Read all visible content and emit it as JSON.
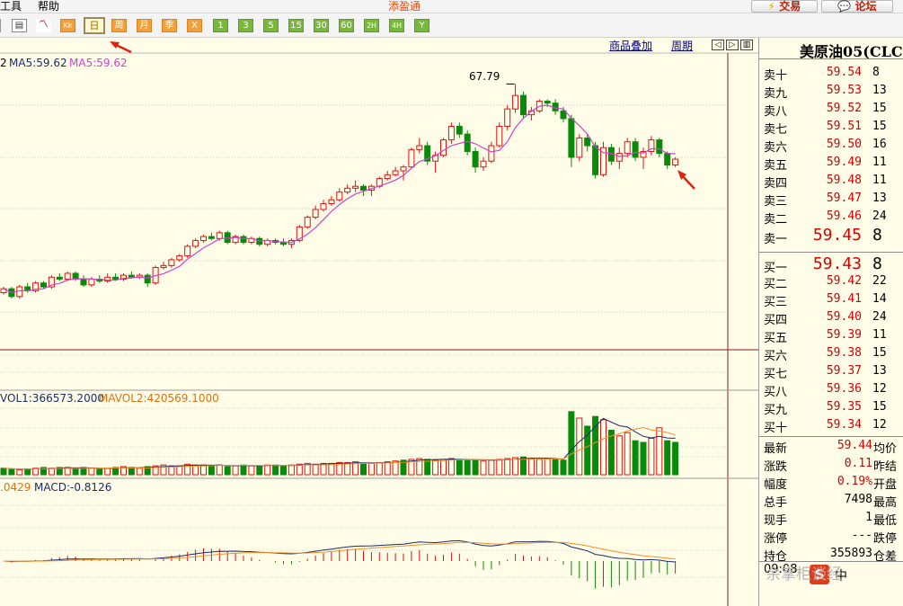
{
  "menu": {
    "items": [
      "工具",
      "帮助"
    ],
    "app_title": "添盈通",
    "trade_btn": "交易",
    "forum_btn": "论坛"
  },
  "toolbar": {
    "period_buttons": [
      "日",
      "周",
      "月",
      "季",
      "X",
      "1",
      "3",
      "5",
      "15",
      "30",
      "60",
      "2H",
      "4H",
      "Y"
    ],
    "active": "日"
  },
  "chart": {
    "links": {
      "overlay": "商品叠加",
      "period": "周期"
    },
    "ma_legend": {
      "ma2": "2",
      "ma5": "MA5:59.62",
      "ma5b": "MA5:59.62"
    },
    "high_label": "67.79",
    "vol_legend": {
      "vol1": "VOL1:366573.2000",
      "mavol2": "MAVOL2:420569.1000"
    },
    "macd_legend": {
      "dea": ".0429",
      "macd": "MACD:-0.8126"
    },
    "colors": {
      "up": "#e01010",
      "down": "#0a8a0a",
      "ma": "#cc44cc",
      "macd_fast": "#1a2d66",
      "macd_slow": "#f0902a",
      "bg": "#fffde8"
    }
  },
  "chart_data": {
    "type": "candlestick",
    "candles_ohlc": [
      [
        57.0,
        57.3,
        56.9,
        57.2
      ],
      [
        57.2,
        57.3,
        56.7,
        56.8
      ],
      [
        56.8,
        57.4,
        56.7,
        57.3
      ],
      [
        57.3,
        57.5,
        57.0,
        57.1
      ],
      [
        57.1,
        57.6,
        57.0,
        57.5
      ],
      [
        57.5,
        57.6,
        57.2,
        57.3
      ],
      [
        57.3,
        57.9,
        57.2,
        57.8
      ],
      [
        57.8,
        58.0,
        57.6,
        57.7
      ],
      [
        57.7,
        58.1,
        57.6,
        58.0
      ],
      [
        58.0,
        58.1,
        57.6,
        57.7
      ],
      [
        57.7,
        57.9,
        57.3,
        57.4
      ],
      [
        57.4,
        57.8,
        57.3,
        57.7
      ],
      [
        57.7,
        57.9,
        57.5,
        57.6
      ],
      [
        57.6,
        58.0,
        57.5,
        57.8
      ],
      [
        57.8,
        58.0,
        57.6,
        57.7
      ],
      [
        57.7,
        58.0,
        57.6,
        57.9
      ],
      [
        57.9,
        58.1,
        57.8,
        57.8
      ],
      [
        57.8,
        58.0,
        57.7,
        57.9
      ],
      [
        57.9,
        58.0,
        57.3,
        57.5
      ],
      [
        57.5,
        58.4,
        57.4,
        58.3
      ],
      [
        58.3,
        58.6,
        58.2,
        58.4
      ],
      [
        58.4,
        58.8,
        58.3,
        58.7
      ],
      [
        58.7,
        59.0,
        58.6,
        58.9
      ],
      [
        58.9,
        59.5,
        58.8,
        59.4
      ],
      [
        59.4,
        59.8,
        59.3,
        59.7
      ],
      [
        59.7,
        60.0,
        59.6,
        59.9
      ],
      [
        59.9,
        60.1,
        59.7,
        59.8
      ],
      [
        59.8,
        60.2,
        59.7,
        60.1
      ],
      [
        60.1,
        60.2,
        59.5,
        59.6
      ],
      [
        59.6,
        60.0,
        59.5,
        59.9
      ],
      [
        59.9,
        60.0,
        59.5,
        59.6
      ],
      [
        59.6,
        59.9,
        59.5,
        59.8
      ],
      [
        59.8,
        59.9,
        59.4,
        59.5
      ],
      [
        59.5,
        59.8,
        59.4,
        59.7
      ],
      [
        59.7,
        59.8,
        59.5,
        59.6
      ],
      [
        59.6,
        59.8,
        59.4,
        59.5
      ],
      [
        59.5,
        59.8,
        59.3,
        59.7
      ],
      [
        59.7,
        60.5,
        59.6,
        60.4
      ],
      [
        60.4,
        61.0,
        60.3,
        60.9
      ],
      [
        60.9,
        61.5,
        60.8,
        61.3
      ],
      [
        61.3,
        61.8,
        61.2,
        61.6
      ],
      [
        61.6,
        62.0,
        61.5,
        61.8
      ],
      [
        61.8,
        62.4,
        61.7,
        62.2
      ],
      [
        62.2,
        62.6,
        62.1,
        62.4
      ],
      [
        62.4,
        62.8,
        62.2,
        62.5
      ],
      [
        62.5,
        62.6,
        62.0,
        62.3
      ],
      [
        62.3,
        62.6,
        62.0,
        62.5
      ],
      [
        62.5,
        63.0,
        62.4,
        62.9
      ],
      [
        62.9,
        63.3,
        62.8,
        63.1
      ],
      [
        63.1,
        63.5,
        63.0,
        63.3
      ],
      [
        63.3,
        63.6,
        62.8,
        63.5
      ],
      [
        63.5,
        64.5,
        63.4,
        64.4
      ],
      [
        64.4,
        65.0,
        64.2,
        64.6
      ],
      [
        64.6,
        64.8,
        63.6,
        63.8
      ],
      [
        63.8,
        64.3,
        63.2,
        64.1
      ],
      [
        64.1,
        65.0,
        64.0,
        64.9
      ],
      [
        64.9,
        65.8,
        64.7,
        65.6
      ],
      [
        65.6,
        65.8,
        65.0,
        65.2
      ],
      [
        65.2,
        65.4,
        64.1,
        64.3
      ],
      [
        64.3,
        64.5,
        63.2,
        63.5
      ],
      [
        63.5,
        64.0,
        63.3,
        63.8
      ],
      [
        63.8,
        64.8,
        63.7,
        64.6
      ],
      [
        64.6,
        65.8,
        64.5,
        65.6
      ],
      [
        65.6,
        66.7,
        65.4,
        66.5
      ],
      [
        66.5,
        67.79,
        66.3,
        67.2
      ],
      [
        67.2,
        67.4,
        66.0,
        66.2
      ],
      [
        66.2,
        66.6,
        65.9,
        66.4
      ],
      [
        66.4,
        67.0,
        66.3,
        66.9
      ],
      [
        66.9,
        67.0,
        66.6,
        66.8
      ],
      [
        66.8,
        67.0,
        66.2,
        66.4
      ],
      [
        66.4,
        66.6,
        65.8,
        66.0
      ],
      [
        66.0,
        66.2,
        63.5,
        64.0
      ],
      [
        64.0,
        65.2,
        63.8,
        65.0
      ],
      [
        65.0,
        65.2,
        64.3,
        64.6
      ],
      [
        64.6,
        64.8,
        62.9,
        63.1
      ],
      [
        63.1,
        64.8,
        63.0,
        64.5
      ],
      [
        64.5,
        64.7,
        63.6,
        63.8
      ],
      [
        63.8,
        64.5,
        63.4,
        64.2
      ],
      [
        64.2,
        65.0,
        64.0,
        64.8
      ],
      [
        64.8,
        65.0,
        63.8,
        64.0
      ],
      [
        64.0,
        64.5,
        63.4,
        64.3
      ],
      [
        64.3,
        65.1,
        64.1,
        64.9
      ],
      [
        64.9,
        65.0,
        64.0,
        64.2
      ],
      [
        64.2,
        64.3,
        63.4,
        63.6
      ],
      [
        63.6,
        64.0,
        63.5,
        63.9
      ]
    ],
    "vol_bars": [
      [
        8,
        0
      ],
      [
        7,
        0
      ],
      [
        6,
        1
      ],
      [
        7,
        0
      ],
      [
        8,
        1
      ],
      [
        9,
        0
      ],
      [
        8,
        1
      ],
      [
        9,
        0
      ],
      [
        9,
        1
      ],
      [
        7,
        0
      ],
      [
        9,
        0
      ],
      [
        8,
        1
      ],
      [
        7,
        0
      ],
      [
        8,
        1
      ],
      [
        9,
        0
      ],
      [
        10,
        1
      ],
      [
        9,
        0
      ],
      [
        8,
        1
      ],
      [
        10,
        0
      ],
      [
        11,
        1
      ],
      [
        12,
        1
      ],
      [
        11,
        1
      ],
      [
        11,
        1
      ],
      [
        13,
        1
      ],
      [
        12,
        1
      ],
      [
        12,
        1
      ],
      [
        11,
        0
      ],
      [
        12,
        1
      ],
      [
        10,
        0
      ],
      [
        11,
        1
      ],
      [
        12,
        0
      ],
      [
        11,
        1
      ],
      [
        11,
        0
      ],
      [
        12,
        1
      ],
      [
        12,
        0
      ],
      [
        11,
        0
      ],
      [
        12,
        1
      ],
      [
        13,
        1
      ],
      [
        14,
        1
      ],
      [
        13,
        1
      ],
      [
        14,
        1
      ],
      [
        14,
        1
      ],
      [
        15,
        1
      ],
      [
        15,
        1
      ],
      [
        16,
        1
      ],
      [
        14,
        0
      ],
      [
        14,
        1
      ],
      [
        15,
        1
      ],
      [
        16,
        1
      ],
      [
        17,
        1
      ],
      [
        18,
        0
      ],
      [
        19,
        1
      ],
      [
        20,
        1
      ],
      [
        19,
        0
      ],
      [
        18,
        1
      ],
      [
        19,
        1
      ],
      [
        20,
        1
      ],
      [
        19,
        0
      ],
      [
        18,
        0
      ],
      [
        18,
        0
      ],
      [
        17,
        1
      ],
      [
        18,
        1
      ],
      [
        19,
        1
      ],
      [
        20,
        1
      ],
      [
        21,
        1
      ],
      [
        22,
        0
      ],
      [
        20,
        1
      ],
      [
        19,
        1
      ],
      [
        20,
        1
      ],
      [
        19,
        0
      ],
      [
        18,
        0
      ],
      [
        78,
        0
      ],
      [
        70,
        1
      ],
      [
        60,
        0
      ],
      [
        72,
        0
      ],
      [
        68,
        1
      ],
      [
        55,
        0
      ],
      [
        48,
        1
      ],
      [
        52,
        1
      ],
      [
        42,
        0
      ],
      [
        40,
        0
      ],
      [
        45,
        1
      ],
      [
        58,
        1
      ],
      [
        42,
        0
      ],
      [
        40,
        0
      ]
    ],
    "macd_hist": [
      0,
      0,
      0,
      0,
      0,
      0,
      0,
      0,
      0,
      0,
      0,
      0,
      0,
      0,
      0,
      0,
      0,
      0,
      0,
      0,
      0,
      0,
      0,
      0,
      0,
      0,
      0,
      0,
      0,
      0,
      0,
      0,
      0,
      0,
      0,
      0,
      0,
      0,
      0,
      0,
      0,
      0,
      0,
      0,
      0,
      0,
      0,
      0,
      0,
      0,
      0,
      0,
      0,
      0,
      0,
      0,
      0,
      0,
      0,
      0,
      0,
      0,
      0,
      0,
      0,
      0,
      0,
      0,
      0,
      0,
      0,
      0,
      0,
      0,
      0,
      0,
      0,
      0,
      0,
      0,
      0,
      0,
      0,
      0,
      0
    ]
  },
  "orderbook": {
    "stock_name": "美原油05(CLC",
    "asks": [
      {
        "label": "卖十",
        "price": "59.54",
        "vol": "8"
      },
      {
        "label": "卖九",
        "price": "59.53",
        "vol": "13"
      },
      {
        "label": "卖八",
        "price": "59.52",
        "vol": "15"
      },
      {
        "label": "卖七",
        "price": "59.51",
        "vol": "15"
      },
      {
        "label": "卖六",
        "price": "59.50",
        "vol": "16"
      },
      {
        "label": "卖五",
        "price": "59.49",
        "vol": "11"
      },
      {
        "label": "卖四",
        "price": "59.48",
        "vol": "11"
      },
      {
        "label": "卖三",
        "price": "59.47",
        "vol": "13"
      },
      {
        "label": "卖二",
        "price": "59.46",
        "vol": "24"
      },
      {
        "label": "卖一",
        "price": "59.45",
        "vol": "8"
      }
    ],
    "bids": [
      {
        "label": "买一",
        "price": "59.43",
        "vol": "8"
      },
      {
        "label": "买二",
        "price": "59.42",
        "vol": "22"
      },
      {
        "label": "买三",
        "price": "59.41",
        "vol": "14"
      },
      {
        "label": "买四",
        "price": "59.40",
        "vol": "24"
      },
      {
        "label": "买五",
        "price": "59.39",
        "vol": "11"
      },
      {
        "label": "买六",
        "price": "59.38",
        "vol": "15"
      },
      {
        "label": "买七",
        "price": "59.37",
        "vol": "13"
      },
      {
        "label": "买八",
        "price": "59.36",
        "vol": "12"
      },
      {
        "label": "买九",
        "price": "59.35",
        "vol": "15"
      },
      {
        "label": "买十",
        "price": "59.34",
        "vol": "12"
      }
    ]
  },
  "stats": [
    {
      "label": "最新",
      "value": "59.44",
      "right": "均价",
      "color": "#d40000"
    },
    {
      "label": "涨跌",
      "value": "0.11",
      "right": "昨结",
      "color": "#d40000"
    },
    {
      "label": "幅度",
      "value": "0.19%",
      "right": "开盘",
      "color": "#d40000"
    },
    {
      "label": "总手",
      "value": "7498",
      "right": "最高",
      "color": "#000000"
    },
    {
      "label": "现手",
      "value": "1",
      "right": "最低",
      "color": "#000000"
    },
    {
      "label": "涨停",
      "value": "---",
      "right": "跌停",
      "color": "#000000"
    },
    {
      "label": "持仓",
      "value": "355893",
      "right": "仓差",
      "color": "#000000"
    }
  ],
  "footer": {
    "time": "09:08",
    "ime": "中",
    "watermark": "余掌柜谈经"
  }
}
